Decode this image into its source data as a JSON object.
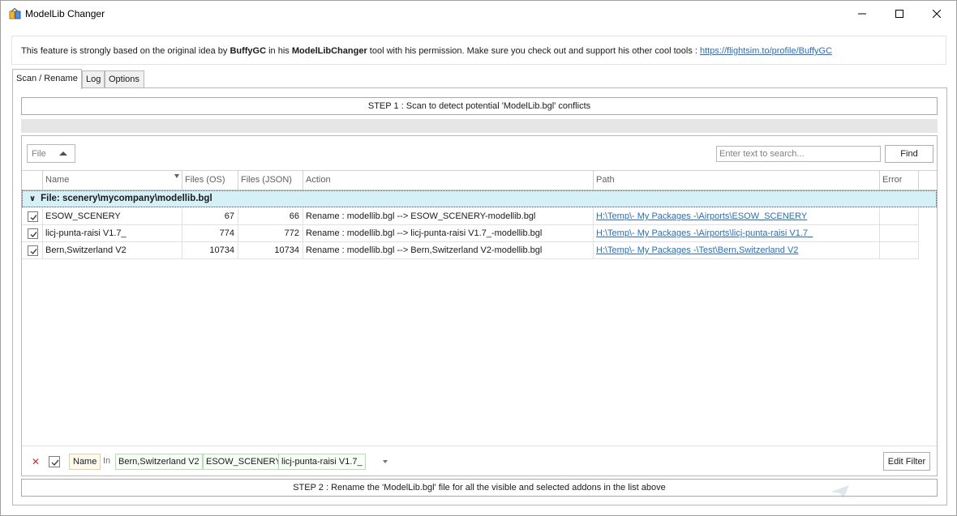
{
  "window": {
    "title": "ModelLib Changer",
    "icon": "window-app-icon",
    "controls": [
      "minimize-icon",
      "maximize-icon",
      "close-icon"
    ]
  },
  "info": {
    "prefix": "This feature is strongly based on the original idea by ",
    "author": "BuffyGC",
    "mid": " in his ",
    "tool": "ModelLibChanger",
    "suffix": " tool with his permission. Make sure you check out and support his other cool tools : ",
    "link": "https://flightsim.to/profile/BuffyGC"
  },
  "tabs": [
    {
      "label": "Scan / Rename",
      "active": true
    },
    {
      "label": "Log",
      "active": false
    },
    {
      "label": "Options",
      "active": false
    }
  ],
  "step1_label": "STEP 1 : Scan to detect potential 'ModelLib.bgl' conflicts",
  "step2_label": "STEP 2 : Rename the 'ModelLib.bgl' file for all the visible and selected addons in the list above",
  "grid": {
    "group_combo": "File",
    "search_placeholder": "Enter text to search...",
    "find_label": "Find",
    "columns": [
      "Name",
      "Files (OS)",
      "Files (JSON)",
      "Action",
      "Path",
      "Error"
    ],
    "group_row": "File: scenery\\mycompany\\modellib.bgl",
    "rows": [
      {
        "checked": true,
        "name": "ESOW_SCENERY",
        "files_os": "67",
        "files_json": "66",
        "action": "Rename : modellib.bgl --> ESOW_SCENERY-modellib.bgl",
        "path": "H:\\Temp\\- My Packages -\\Airports\\ESOW_SCENERY",
        "error": ""
      },
      {
        "checked": true,
        "name": "licj-punta-raisi V1.7_",
        "files_os": "774",
        "files_json": "772",
        "action": "Rename : modellib.bgl --> licj-punta-raisi V1.7_-modellib.bgl",
        "path": "H:\\Temp\\- My Packages -\\Airports\\licj-punta-raisi V1.7_",
        "error": ""
      },
      {
        "checked": true,
        "name": "Bern,Switzerland V2",
        "files_os": "10734",
        "files_json": "10734",
        "action": "Rename : modellib.bgl --> Bern,Switzerland V2-modellib.bgl",
        "path": "H:\\Temp\\- My Packages -\\Test\\Bern,Switzerland V2",
        "error": ""
      }
    ]
  },
  "filter": {
    "field": "Name",
    "operator": "In",
    "values": [
      "Bern,Switzerland V2",
      "ESOW_SCENERY",
      "licj-punta-raisi V1.7_"
    ],
    "edit_label": "Edit Filter"
  }
}
